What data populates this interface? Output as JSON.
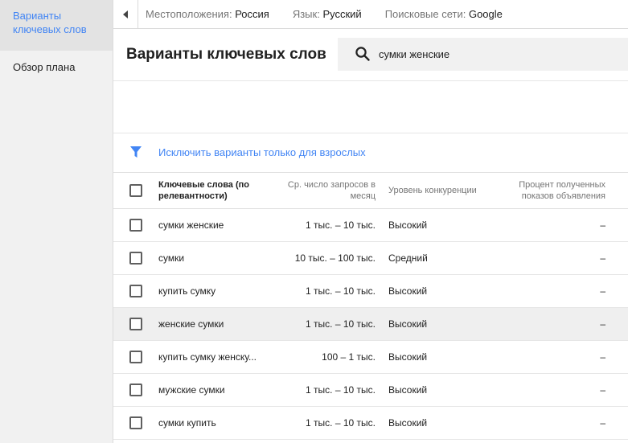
{
  "sidebar": {
    "items": [
      {
        "label": "Варианты ключевых слов"
      },
      {
        "label": "Обзор плана"
      }
    ]
  },
  "topbar": {
    "filters": [
      {
        "label": "Местоположения:",
        "value": "Россия"
      },
      {
        "label": "Язык:",
        "value": "Русский"
      },
      {
        "label": "Поисковые сети:",
        "value": "Google"
      }
    ]
  },
  "header": {
    "title": "Варианты ключевых слов",
    "search_value": "сумки женские"
  },
  "exclude_link": "Исключить варианты только для взрослых",
  "table": {
    "columns": [
      "Ключевые слова (по релевантности)",
      "Ср. число запросов в месяц",
      "Уровень конкуренции",
      "Процент полученных показов объявления"
    ],
    "rows": [
      {
        "keyword": "сумки женские",
        "avg": "1 тыс. – 10 тыс.",
        "competition": "Высокий",
        "impr": "–"
      },
      {
        "keyword": "сумки",
        "avg": "10 тыс. – 100 тыс.",
        "competition": "Средний",
        "impr": "–"
      },
      {
        "keyword": "купить сумку",
        "avg": "1 тыс. – 10 тыс.",
        "competition": "Высокий",
        "impr": "–"
      },
      {
        "keyword": "женские сумки",
        "avg": "1 тыс. – 10 тыс.",
        "competition": "Высокий",
        "impr": "–"
      },
      {
        "keyword": "купить сумку женску...",
        "avg": "100 – 1 тыс.",
        "competition": "Высокий",
        "impr": "–"
      },
      {
        "keyword": "мужские сумки",
        "avg": "1 тыс. – 10 тыс.",
        "competition": "Высокий",
        "impr": "–"
      },
      {
        "keyword": "сумки купить",
        "avg": "1 тыс. – 10 тыс.",
        "competition": "Высокий",
        "impr": "–"
      }
    ]
  },
  "colors": {
    "accent": "#4285f4"
  }
}
